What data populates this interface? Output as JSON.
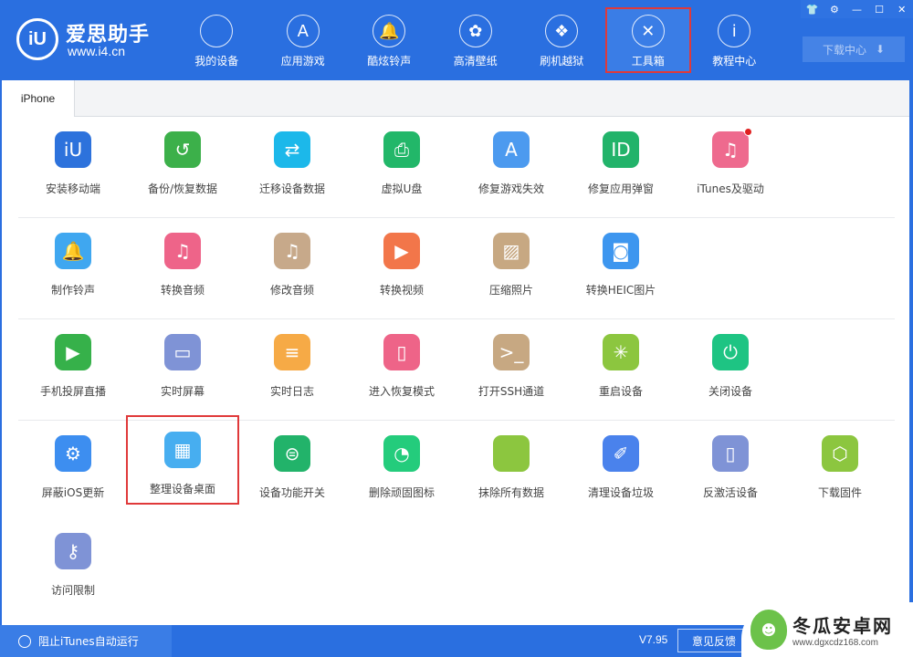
{
  "app": {
    "name": "爱思助手",
    "url": "www.i4.cn",
    "logo_glyph": "iU"
  },
  "nav": [
    {
      "label": "我的设备",
      "icon": "apple-icon",
      "glyph": ""
    },
    {
      "label": "应用游戏",
      "icon": "app-store-icon",
      "glyph": "A"
    },
    {
      "label": "酷炫铃声",
      "icon": "bell-icon",
      "glyph": "🔔"
    },
    {
      "label": "高清壁纸",
      "icon": "flower-icon",
      "glyph": "✿"
    },
    {
      "label": "刷机越狱",
      "icon": "dropbox-icon",
      "glyph": "❖"
    },
    {
      "label": "工具箱",
      "icon": "tools-icon",
      "glyph": "✕",
      "active": true
    },
    {
      "label": "教程中心",
      "icon": "info-icon",
      "glyph": "i"
    }
  ],
  "window_controls": {
    "skin": "👕",
    "settings": "⚙",
    "minimize": "—",
    "maximize": "☐",
    "close": "✕"
  },
  "download_center": {
    "label": "下载中心",
    "icon": "⬇"
  },
  "tabs": [
    {
      "label": "iPhone",
      "active": true
    }
  ],
  "tools": [
    [
      {
        "name": "安装移动端",
        "icon": "i4-app-icon",
        "glyph": "iU",
        "color": "#2d72dc"
      },
      {
        "name": "备份/恢复数据",
        "icon": "backup-restore-icon",
        "glyph": "↺",
        "color": "#3cb04a"
      },
      {
        "name": "迁移设备数据",
        "icon": "migrate-data-icon",
        "glyph": "⇄",
        "color": "#1cb8ea"
      },
      {
        "name": "虚拟U盘",
        "icon": "usb-drive-icon",
        "glyph": "⎙",
        "color": "#22b769"
      },
      {
        "name": "修复游戏失效",
        "icon": "fix-app-icon",
        "glyph": "A",
        "color": "#4c9aef"
      },
      {
        "name": "修复应用弹窗",
        "icon": "apple-id-icon",
        "glyph": "ID",
        "color": "#22b36a"
      },
      {
        "name": "iTunes及驱动",
        "icon": "itunes-driver-icon",
        "glyph": "♫",
        "color": "#ee6a8e",
        "badge": true
      }
    ],
    [
      {
        "name": "制作铃声",
        "icon": "make-ringtone-icon",
        "glyph": "🔔",
        "color": "#3fa7f0"
      },
      {
        "name": "转换音频",
        "icon": "convert-audio-icon",
        "glyph": "♫",
        "color": "#ee6489"
      },
      {
        "name": "修改音频",
        "icon": "edit-audio-icon",
        "glyph": "♫",
        "color": "#c7a98a"
      },
      {
        "name": "转换视频",
        "icon": "convert-video-icon",
        "glyph": "▶",
        "color": "#f2764a"
      },
      {
        "name": "压缩照片",
        "icon": "compress-photo-icon",
        "glyph": "▨",
        "color": "#c7a882"
      },
      {
        "name": "转换HEIC图片",
        "icon": "convert-heic-icon",
        "glyph": "◙",
        "color": "#3d96ef"
      }
    ],
    [
      {
        "name": "手机投屏直播",
        "icon": "screen-mirror-icon",
        "glyph": "▶",
        "color": "#36b14a"
      },
      {
        "name": "实时屏幕",
        "icon": "realtime-screen-icon",
        "glyph": "▭",
        "color": "#7f93d6"
      },
      {
        "name": "实时日志",
        "icon": "realtime-log-icon",
        "glyph": "≡",
        "color": "#f6aa46"
      },
      {
        "name": "进入恢复模式",
        "icon": "recovery-mode-icon",
        "glyph": "▯",
        "color": "#ee6488"
      },
      {
        "name": "打开SSH通道",
        "icon": "ssh-terminal-icon",
        "glyph": ">_",
        "color": "#c7a882"
      },
      {
        "name": "重启设备",
        "icon": "restart-icon",
        "glyph": "✳",
        "color": "#8cc63f"
      },
      {
        "name": "关闭设备",
        "icon": "power-icon",
        "glyph": "⏻",
        "color": "#1ec483"
      }
    ],
    [
      {
        "name": "屏蔽iOS更新",
        "icon": "block-update-icon",
        "glyph": "⚙",
        "color": "#3d8ef0"
      },
      {
        "name": "整理设备桌面",
        "icon": "organize-desktop-icon",
        "glyph": "▦",
        "color": "#47aef0",
        "highlight": true
      },
      {
        "name": "设备功能开关",
        "icon": "feature-toggle-icon",
        "glyph": "⊜",
        "color": "#22b36a"
      },
      {
        "name": "删除顽固图标",
        "icon": "delete-icon-icon",
        "glyph": "◔",
        "color": "#24cc7c"
      },
      {
        "name": "抹除所有数据",
        "icon": "erase-data-icon",
        "glyph": "",
        "color": "#8cc63f"
      },
      {
        "name": "清理设备垃圾",
        "icon": "clean-junk-icon",
        "glyph": "✐",
        "color": "#4a82ec"
      },
      {
        "name": "反激活设备",
        "icon": "deactivate-icon",
        "glyph": "▯",
        "color": "#7f93d6"
      },
      {
        "name": "下载固件",
        "icon": "firmware-icon",
        "glyph": "⬡",
        "color": "#8cc63f"
      }
    ],
    [
      {
        "name": "访问限制",
        "icon": "restrictions-key-icon",
        "glyph": "⚷",
        "color": "#7f93d6"
      }
    ]
  ],
  "statusbar": {
    "itunes_block_label": "阻止iTunes自动运行",
    "version": "V7.95",
    "feedback_label": "意见反馈"
  },
  "watermark": {
    "name": "冬瓜安卓网",
    "url": "www.dgxcdz168.com"
  }
}
